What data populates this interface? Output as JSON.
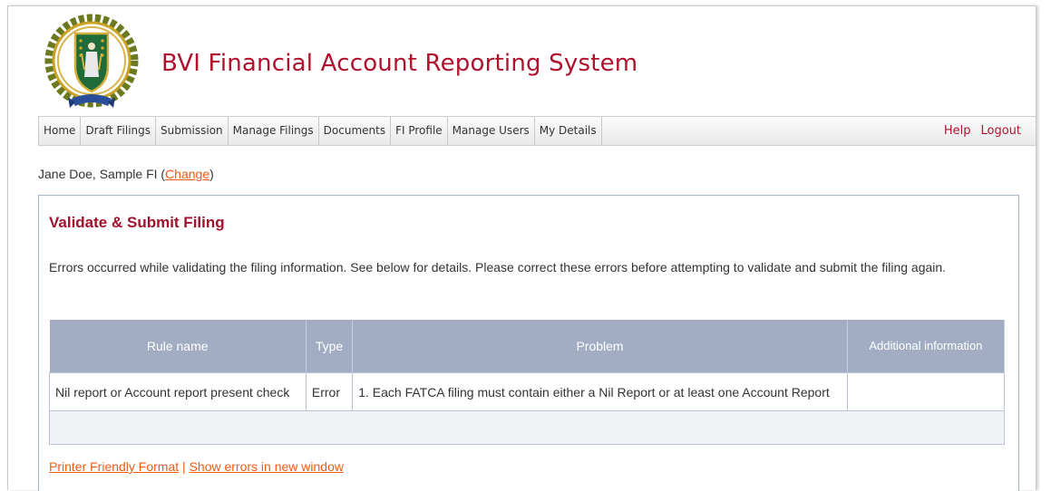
{
  "app": {
    "title": "BVI Financial Account Reporting System",
    "brand_color": "#b0122d",
    "logo_text": "VIRGIN ISLANDS"
  },
  "nav": {
    "items": [
      {
        "label": "Home"
      },
      {
        "label": "Draft Filings"
      },
      {
        "label": "Submission"
      },
      {
        "label": "Manage Filings"
      },
      {
        "label": "Documents"
      },
      {
        "label": "FI Profile"
      },
      {
        "label": "Manage Users"
      },
      {
        "label": "My Details"
      }
    ],
    "help": "Help",
    "logout": "Logout"
  },
  "user": {
    "text": "Jane Doe, Sample FI (",
    "change_label": "Change",
    "close_paren": ")"
  },
  "panel": {
    "title": "Validate & Submit Filing",
    "message": "Errors occurred while validating the filing information. See below for details. Please correct these errors before attempting to validate and submit the filing again."
  },
  "grid": {
    "columns": [
      "Rule name",
      "Type",
      "Problem",
      "Additional information"
    ],
    "rows": [
      {
        "rule_name": "Nil report or Account report present check",
        "type": "Error",
        "problem": "1. Each FATCA filing must contain either a Nil Report or at least one Account Report",
        "additional": ""
      }
    ]
  },
  "footer": {
    "printer_friendly": "Printer Friendly Format",
    "separator": "|",
    "show_errors": "Show errors in new window"
  }
}
